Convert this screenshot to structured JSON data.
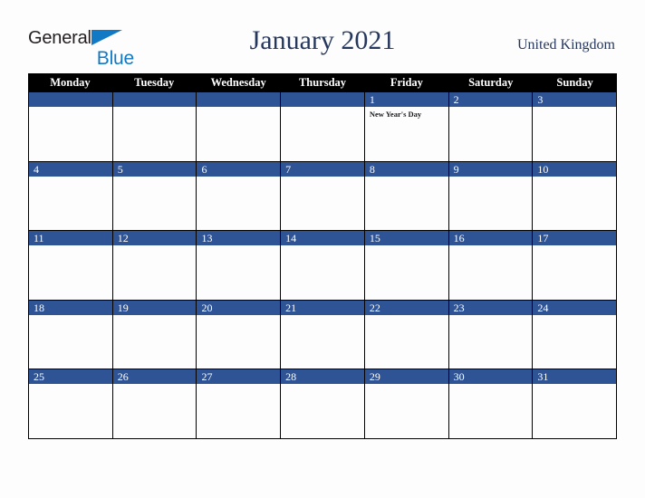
{
  "brand": {
    "name_part1": "General",
    "name_part2": "Blue",
    "triangle_icon": "triangle-icon",
    "color_dark": "#231f20",
    "color_blue": "#1279c4"
  },
  "header": {
    "title": "January 2021",
    "country": "United Kingdom",
    "title_color": "#26375e"
  },
  "calendar": {
    "weekday_headers": [
      "Monday",
      "Tuesday",
      "Wednesday",
      "Thursday",
      "Friday",
      "Saturday",
      "Sunday"
    ],
    "header_bg": "#000000",
    "header_text": "#ffffff",
    "day_bar_bg": "#2f5496",
    "day_bar_text": "#ffffff",
    "grid_line": "#000000",
    "weeks": [
      [
        {
          "day": "",
          "events": []
        },
        {
          "day": "",
          "events": []
        },
        {
          "day": "",
          "events": []
        },
        {
          "day": "",
          "events": []
        },
        {
          "day": "1",
          "events": [
            "New Year's Day"
          ]
        },
        {
          "day": "2",
          "events": []
        },
        {
          "day": "3",
          "events": []
        }
      ],
      [
        {
          "day": "4",
          "events": []
        },
        {
          "day": "5",
          "events": []
        },
        {
          "day": "6",
          "events": []
        },
        {
          "day": "7",
          "events": []
        },
        {
          "day": "8",
          "events": []
        },
        {
          "day": "9",
          "events": []
        },
        {
          "day": "10",
          "events": []
        }
      ],
      [
        {
          "day": "11",
          "events": []
        },
        {
          "day": "12",
          "events": []
        },
        {
          "day": "13",
          "events": []
        },
        {
          "day": "14",
          "events": []
        },
        {
          "day": "15",
          "events": []
        },
        {
          "day": "16",
          "events": []
        },
        {
          "day": "17",
          "events": []
        }
      ],
      [
        {
          "day": "18",
          "events": []
        },
        {
          "day": "19",
          "events": []
        },
        {
          "day": "20",
          "events": []
        },
        {
          "day": "21",
          "events": []
        },
        {
          "day": "22",
          "events": []
        },
        {
          "day": "23",
          "events": []
        },
        {
          "day": "24",
          "events": []
        }
      ],
      [
        {
          "day": "25",
          "events": []
        },
        {
          "day": "26",
          "events": []
        },
        {
          "day": "27",
          "events": []
        },
        {
          "day": "28",
          "events": []
        },
        {
          "day": "29",
          "events": []
        },
        {
          "day": "30",
          "events": []
        },
        {
          "day": "31",
          "events": []
        }
      ]
    ]
  }
}
